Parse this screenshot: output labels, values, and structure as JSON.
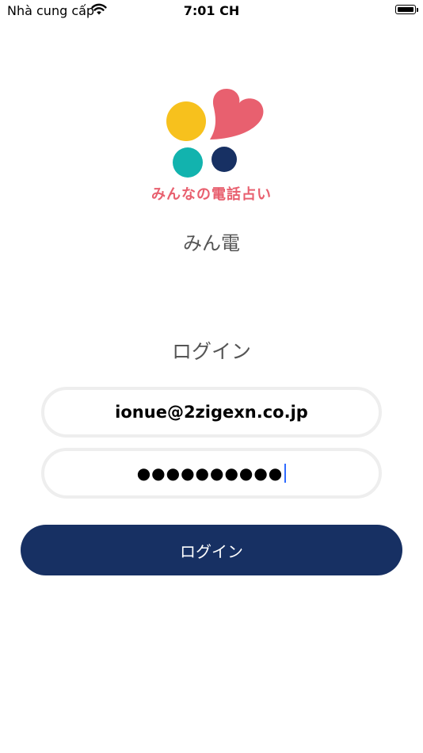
{
  "status_bar": {
    "carrier": "Nhà cung cấp",
    "time": "7:01 CH"
  },
  "brand": {
    "logo_text": "みんなの電話占い",
    "app_name": "みん電",
    "colors": {
      "yellow": "#f7c11d",
      "pink": "#e8606f",
      "teal": "#12b3ae",
      "navy": "#173063"
    }
  },
  "login": {
    "heading": "ログイン",
    "email_value": "ionue@2zigexn.co.jp",
    "password_masked": "●●●●●●●●●●",
    "button_label": "ログイン"
  }
}
